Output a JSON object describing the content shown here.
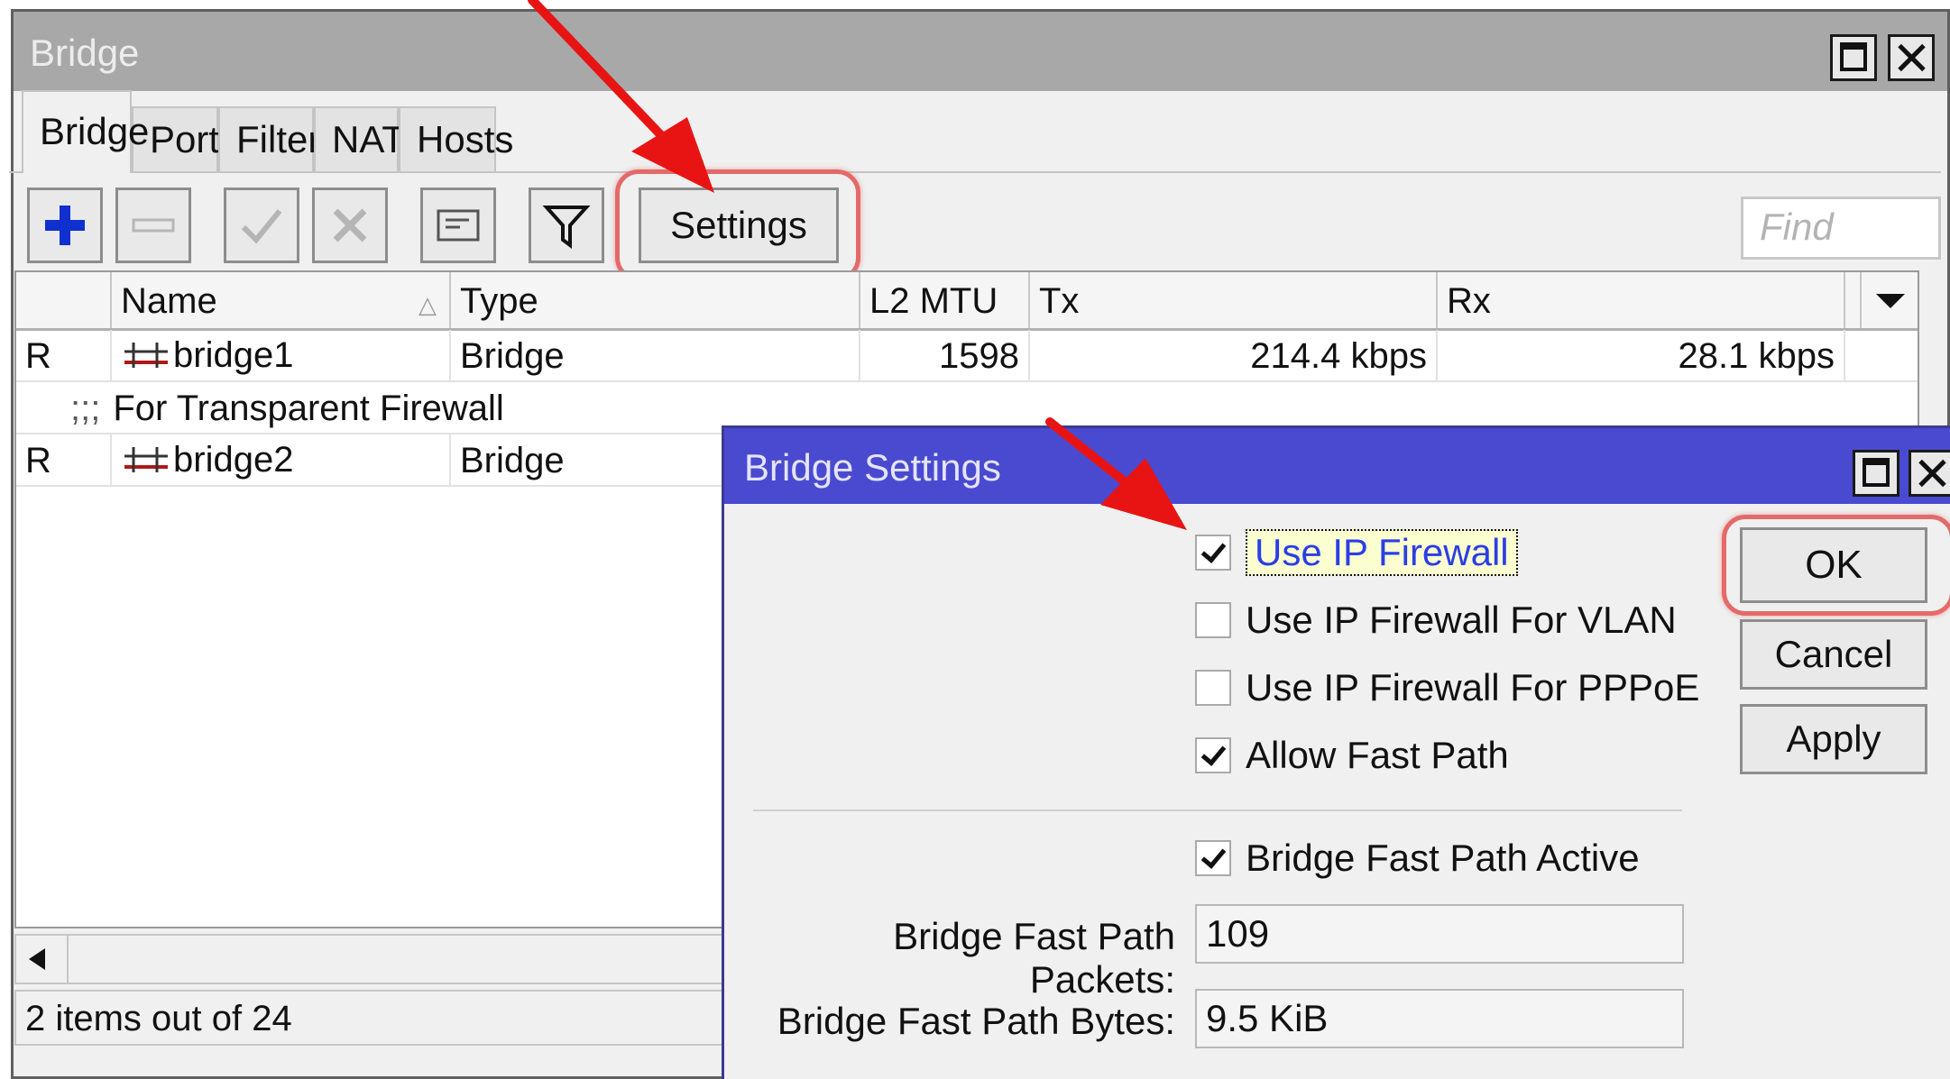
{
  "bridge_window": {
    "title": "Bridge",
    "tabs": [
      "Bridge",
      "Ports",
      "Filters",
      "NAT",
      "Hosts"
    ],
    "toolbar": {
      "add_icon": "plus-icon",
      "remove_icon": "minus-icon",
      "enable_icon": "check-icon",
      "disable_icon": "cross-icon",
      "comment_icon": "note-icon",
      "filter_icon": "funnel-icon",
      "settings_label": "Settings",
      "find_placeholder": "Find"
    },
    "table": {
      "columns": [
        "",
        "Name",
        "Type",
        "L2 MTU",
        "Tx",
        "Rx"
      ],
      "rows": [
        {
          "flag": "R",
          "name": "bridge1",
          "type": "Bridge",
          "l2mtu": "1598",
          "tx": "214.4 kbps",
          "rx": "28.1 kbps"
        },
        {
          "comment_sep": ";;;",
          "comment": "For Transparent Firewall"
        },
        {
          "flag": "R",
          "name": "bridge2",
          "type": "Bridge",
          "l2mtu": "",
          "tx": "",
          "rx": ""
        }
      ]
    },
    "status": "2 items out of 24"
  },
  "settings_dialog": {
    "title": "Bridge Settings",
    "checkboxes": [
      {
        "label": "Use IP Firewall",
        "checked": true
      },
      {
        "label": "Use IP Firewall For VLAN",
        "checked": false
      },
      {
        "label": "Use IP Firewall For PPPoE",
        "checked": false
      },
      {
        "label": "Allow Fast Path",
        "checked": true
      },
      {
        "label": "Bridge Fast Path Active",
        "checked": true
      }
    ],
    "fields": [
      {
        "label": "Bridge Fast Path Packets:",
        "value": "109"
      },
      {
        "label": "Bridge Fast Path Bytes:",
        "value": "9.5 KiB"
      }
    ],
    "buttons": {
      "ok": "OK",
      "cancel": "Cancel",
      "apply": "Apply"
    }
  },
  "colors": {
    "dialog_title": "#4a4ad0",
    "highlight": "#e46a6a",
    "arrow": "#e81414",
    "focus_text": "#2b3ee6"
  }
}
